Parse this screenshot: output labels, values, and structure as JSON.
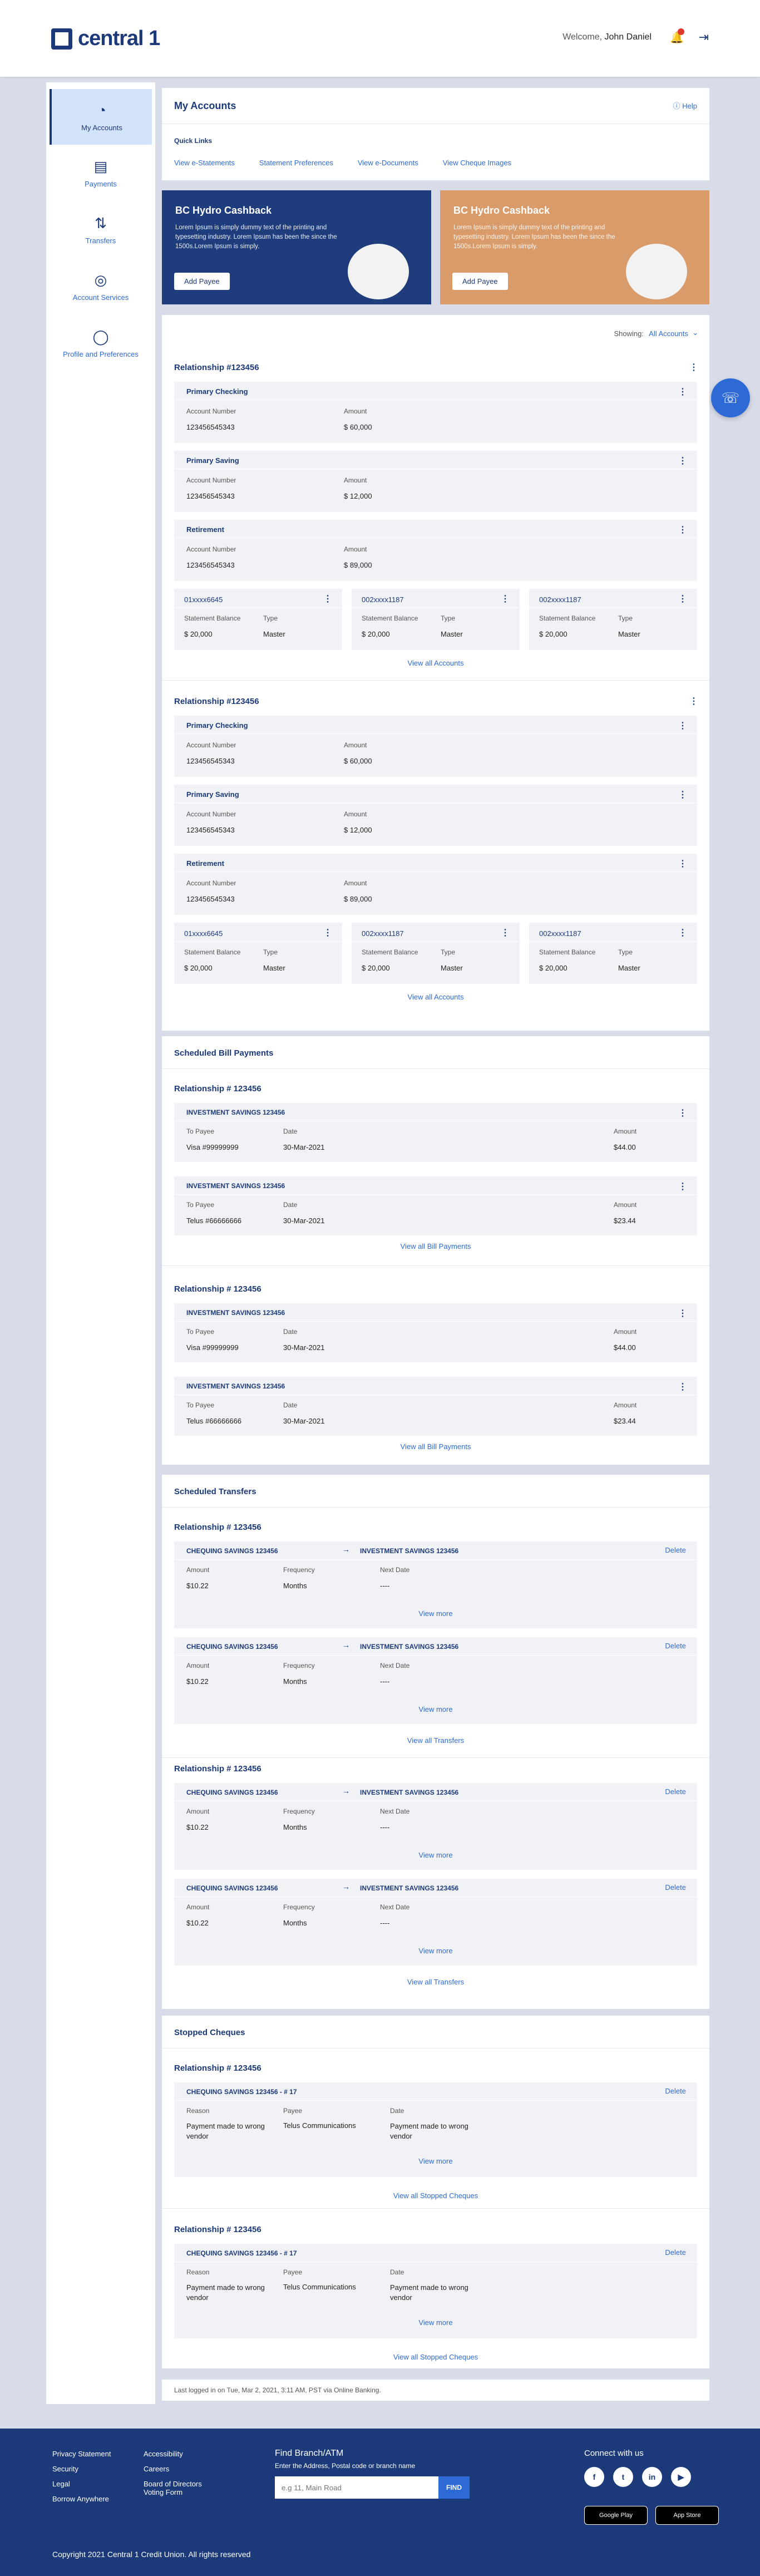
{
  "header": {
    "logo": "central 1",
    "welcome_prefix": "Welcome,",
    "user": "John Daniel"
  },
  "sidebar": {
    "items": [
      {
        "label": "My Accounts"
      },
      {
        "label": "Payments"
      },
      {
        "label": "Transfers"
      },
      {
        "label": "Account Services"
      },
      {
        "label": "Profile and Preferences"
      }
    ]
  },
  "accounts": {
    "title": "My Accounts",
    "help": "Help",
    "quick_links_title": "Quick Links",
    "quick_links": [
      "View e-Statements",
      "Statement Preferences",
      "View e-Documents",
      "View Cheque Images"
    ]
  },
  "banners": [
    {
      "title": "BC Hydro Cashback",
      "text": "Lorem Ipsum is simply dummy text of the printing and typesetting industry. Lorem Ipsum has been the since the 1500s.Lorem Ipsum is simply.",
      "button": "Add Payee",
      "color": "#1f3d7c"
    },
    {
      "title": "BC Hydro Cashback",
      "text": "Lorem Ipsum is simply dummy text of the printing and typesetting industry. Lorem Ipsum has been the since the 1500s.Lorem Ipsum is simply.",
      "button": "Add Payee",
      "color": "#d99b6a"
    }
  ],
  "filter": {
    "label": "Showing:",
    "value": "All Accounts"
  },
  "relationships": [
    {
      "title": "Relationship #123456",
      "accounts": [
        {
          "name": "Primary Checking",
          "no_label": "Account Number",
          "no": "123456545343",
          "amt_label": "Amount",
          "amt": "$ 60,000"
        },
        {
          "name": "Primary Saving",
          "no_label": "Account Number",
          "no": "123456545343",
          "amt_label": "Amount",
          "amt": "$ 12,000"
        },
        {
          "name": "Retirement",
          "no_label": "Account Number",
          "no": "123456545343",
          "amt_label": "Amount",
          "amt": "$ 89,000"
        }
      ],
      "cards": [
        {
          "name": "01xxxx6645",
          "bal_label": "Statement Balance",
          "bal": "$ 20,000",
          "type_label": "Type",
          "type": "Master"
        },
        {
          "name": "002xxxx1187",
          "bal_label": "Statement Balance",
          "bal": "$ 20,000",
          "type_label": "Type",
          "type": "Master"
        },
        {
          "name": "002xxxx1187",
          "bal_label": "Statement Balance",
          "bal": "$ 20,000",
          "type_label": "Type",
          "type": "Master"
        }
      ],
      "view_all": "View all Accounts"
    },
    {
      "title": "Relationship #123456",
      "accounts": [
        {
          "name": "Primary Checking",
          "no_label": "Account Number",
          "no": "123456545343",
          "amt_label": "Amount",
          "amt": "$ 60,000"
        },
        {
          "name": "Primary Saving",
          "no_label": "Account Number",
          "no": "123456545343",
          "amt_label": "Amount",
          "amt": "$ 12,000"
        },
        {
          "name": "Retirement",
          "no_label": "Account Number",
          "no": "123456545343",
          "amt_label": "Amount",
          "amt": "$ 89,000"
        }
      ],
      "cards": [
        {
          "name": "01xxxx6645",
          "bal_label": "Statement Balance",
          "bal": "$ 20,000",
          "type_label": "Type",
          "type": "Master"
        },
        {
          "name": "002xxxx1187",
          "bal_label": "Statement Balance",
          "bal": "$ 20,000",
          "type_label": "Type",
          "type": "Master"
        },
        {
          "name": "002xxxx1187",
          "bal_label": "Statement Balance",
          "bal": "$ 20,000",
          "type_label": "Type",
          "type": "Master"
        }
      ],
      "view_all": "View all Accounts"
    }
  ],
  "bills": {
    "title": "Scheduled Bill Payments",
    "groups": [
      {
        "title": "Relationship # 123456",
        "items": [
          {
            "name": "INVESTMENT SAVINGS 123456",
            "payee_label": "To Payee",
            "payee": "Visa  #99999999",
            "date_label": "Date",
            "date": "30-Mar-2021",
            "amt_label": "Amount",
            "amt": "$44.00"
          },
          {
            "name": "INVESTMENT SAVINGS 123456",
            "payee_label": "To Payee",
            "payee": "Telus  #66666666",
            "date_label": "Date",
            "date": "30-Mar-2021",
            "amt_label": "Amount",
            "amt": "$23.44"
          }
        ],
        "view_all": "View all Bill Payments"
      },
      {
        "title": "Relationship # 123456",
        "items": [
          {
            "name": "INVESTMENT SAVINGS 123456",
            "payee_label": "To Payee",
            "payee": "Visa  #99999999",
            "date_label": "Date",
            "date": "30-Mar-2021",
            "amt_label": "Amount",
            "amt": "$44.00"
          },
          {
            "name": "INVESTMENT SAVINGS 123456",
            "payee_label": "To Payee",
            "payee": "Telus  #66666666",
            "date_label": "Date",
            "date": "30-Mar-2021",
            "amt_label": "Amount",
            "amt": "$23.44"
          }
        ],
        "view_all": "View all Bill Payments"
      }
    ]
  },
  "transfers": {
    "title": "Scheduled Transfers",
    "groups": [
      {
        "title": "Relationship # 123456",
        "items": [
          {
            "from": "CHEQUING SAVINGS 123456",
            "to": "INVESTMENT SAVINGS 123456",
            "delete": "Delete",
            "amt_label": "Amount",
            "amt": "$10.22",
            "freq_label": "Frequency",
            "freq": "Months",
            "next_label": "Next Date",
            "next": "----",
            "more": "View more"
          },
          {
            "from": "CHEQUING SAVINGS 123456",
            "to": "INVESTMENT SAVINGS 123456",
            "delete": "Delete",
            "amt_label": "Amount",
            "amt": "$10.22",
            "freq_label": "Frequency",
            "freq": "Months",
            "next_label": "Next Date",
            "next": "----",
            "more": "View more"
          }
        ],
        "view_all": "View all Transfers"
      },
      {
        "title": "Relationship # 123456",
        "items": [
          {
            "from": "CHEQUING SAVINGS 123456",
            "to": "INVESTMENT SAVINGS 123456",
            "delete": "Delete",
            "amt_label": "Amount",
            "amt": "$10.22",
            "freq_label": "Frequency",
            "freq": "Months",
            "next_label": "Next Date",
            "next": "----",
            "more": "View more"
          },
          {
            "from": "CHEQUING SAVINGS 123456",
            "to": "INVESTMENT SAVINGS 123456",
            "delete": "Delete",
            "amt_label": "Amount",
            "amt": "$10.22",
            "freq_label": "Frequency",
            "freq": "Months",
            "next_label": "Next Date",
            "next": "----",
            "more": "View more"
          }
        ],
        "view_all": "View all Transfers"
      }
    ]
  },
  "cheques": {
    "title": "Stopped Cheques",
    "groups": [
      {
        "title": "Relationship # 123456",
        "item": {
          "name": "CHEQUING SAVINGS 123456  -  # 17",
          "delete": "Delete",
          "reason_label": "Reason",
          "reason": "Payment made to wrong vendor",
          "payee_label": "Payee",
          "payee": "Telus Communications",
          "date_label": "Date",
          "date": "Payment made to wrong vendor",
          "more": "View more"
        },
        "view_all": "View all Stopped Cheques"
      },
      {
        "title": "Relationship # 123456",
        "item": {
          "name": "CHEQUING SAVINGS 123456  -  # 17",
          "delete": "Delete",
          "reason_label": "Reason",
          "reason": "Payment made to wrong vendor",
          "payee_label": "Payee",
          "payee": "Telus Communications",
          "date_label": "Date",
          "date": "Payment made to wrong vendor",
          "more": "View more"
        },
        "view_all": "View all Stopped Cheques"
      }
    ]
  },
  "last_login": "Last logged in on Tue, Mar 2, 2021, 3:11 AM, PST via Online Banking.",
  "footer": {
    "links1": [
      "Privacy Statement",
      "Security",
      "Legal",
      "Borrow Anywhere"
    ],
    "links2": [
      "Accessibility",
      "Careers",
      "Board of Directors Voting Form"
    ],
    "find_title": "Find Branch/ATM",
    "find_sub": "Enter the Address, Postal code or branch name",
    "find_placeholder": "e.g 11, Main Road",
    "find_btn": "FIND",
    "connect": "Connect with us",
    "social": [
      "f",
      "t",
      "in",
      "▶"
    ],
    "stores": [
      "Google Play",
      "App Store"
    ],
    "copyright": "Copyright 2021 Central 1 Credit Union. All rights reserved"
  }
}
